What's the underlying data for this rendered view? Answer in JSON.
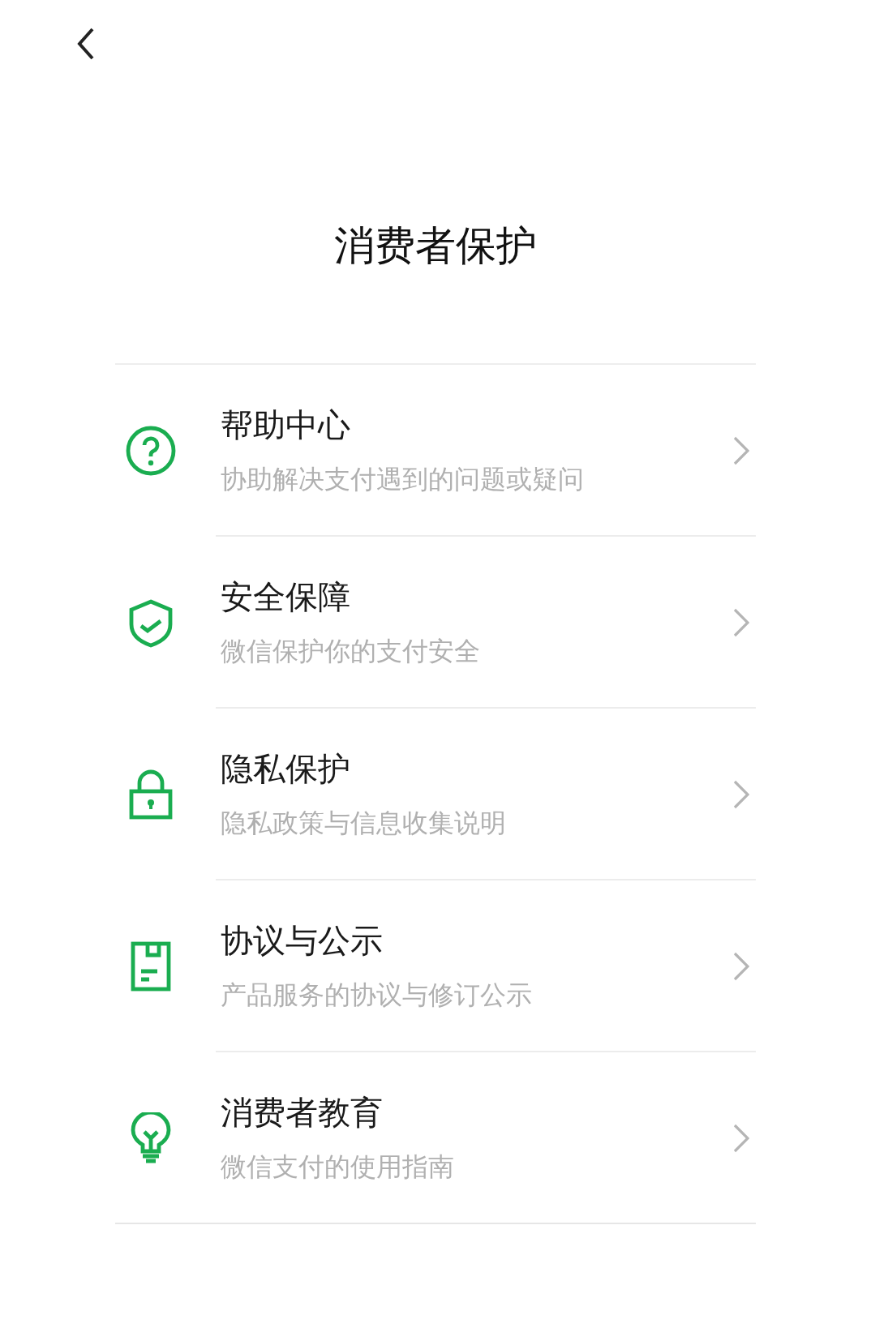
{
  "title": "消费者保护",
  "items": [
    {
      "title": "帮助中心",
      "subtitle": "协助解决支付遇到的问题或疑问"
    },
    {
      "title": "安全保障",
      "subtitle": "微信保护你的支付安全"
    },
    {
      "title": "隐私保护",
      "subtitle": "隐私政策与信息收集说明"
    },
    {
      "title": "协议与公示",
      "subtitle": "产品服务的协议与修订公示"
    },
    {
      "title": "消费者教育",
      "subtitle": "微信支付的使用指南"
    }
  ]
}
